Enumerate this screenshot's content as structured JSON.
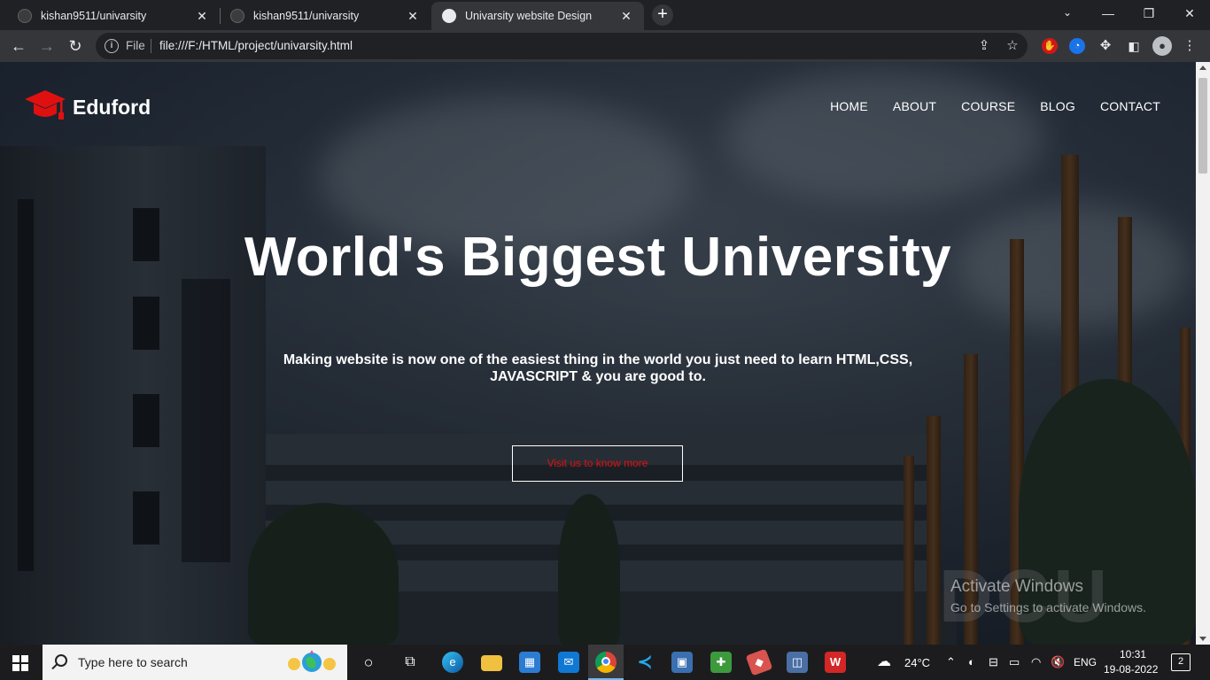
{
  "browser": {
    "tabs": [
      {
        "title": "kishan9511/univarsity",
        "active": false
      },
      {
        "title": "kishan9511/univarsity",
        "active": false
      },
      {
        "title": "Univarsity website Design",
        "active": true
      }
    ],
    "new_tab_label": "+",
    "address": {
      "scheme_label": "File",
      "url": "file:///F:/HTML/project/univarsity.html"
    }
  },
  "site": {
    "logo_text": "Eduford",
    "nav": [
      "HOME",
      "ABOUT",
      "COURSE",
      "BLOG",
      "CONTACT"
    ],
    "hero": {
      "title": "World's Biggest University",
      "subtitle_line1": "Making website is now one of the easiest thing in the world you just need to learn HTML,CSS,",
      "subtitle_line2": "JAVASCRIPT & you are good to.",
      "cta": "Visit us to know more"
    },
    "background_sign": "DCU"
  },
  "watermark": {
    "line1": "Activate Windows",
    "line2": "Go to Settings to activate Windows."
  },
  "taskbar": {
    "search_placeholder": "Type here to search",
    "weather": "24°C",
    "language": "ENG",
    "time": "10:31",
    "date": "19-08-2022",
    "notification_count": "2"
  },
  "colors": {
    "accent_red": "#e01010",
    "chrome_dark": "#202124",
    "chrome_toolbar": "#35363a"
  }
}
